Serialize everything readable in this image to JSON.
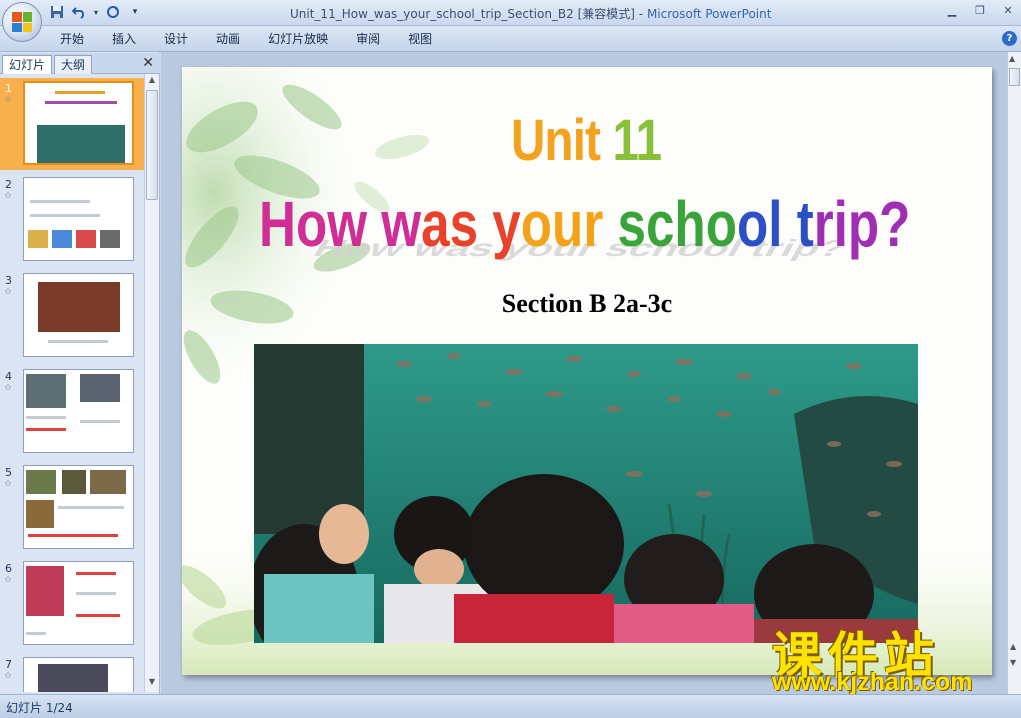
{
  "window": {
    "title": "Unit_11_How_was_your_school_trip_Section_B2 [兼容模式]",
    "separator": " - ",
    "app": "Microsoft PowerPoint"
  },
  "ribbon": {
    "tabs": [
      "开始",
      "插入",
      "设计",
      "动画",
      "幻灯片放映",
      "审阅",
      "视图"
    ]
  },
  "panel": {
    "tab_slides": "幻灯片",
    "tab_outline": "大纲",
    "thumbnails": [
      {
        "num": "1"
      },
      {
        "num": "2"
      },
      {
        "num": "3"
      },
      {
        "num": "4"
      },
      {
        "num": "5"
      },
      {
        "num": "6"
      },
      {
        "num": "7"
      }
    ]
  },
  "slide": {
    "unit_a": "Unit",
    "unit_b": " 11",
    "question": "How was your school trip?",
    "section": "Section B  2a-3c"
  },
  "watermark": {
    "chinese": "课件站",
    "url": "www.kjzhan.com"
  },
  "status": {
    "slide_counter": "幻灯片 1/24"
  },
  "colors": {
    "selected_thumb": "#f7b04b",
    "question_gradient": [
      "#d02e96",
      "#e8432a",
      "#f5a21b",
      "#3aa43a",
      "#2a4fc6",
      "#a02eb4"
    ]
  }
}
